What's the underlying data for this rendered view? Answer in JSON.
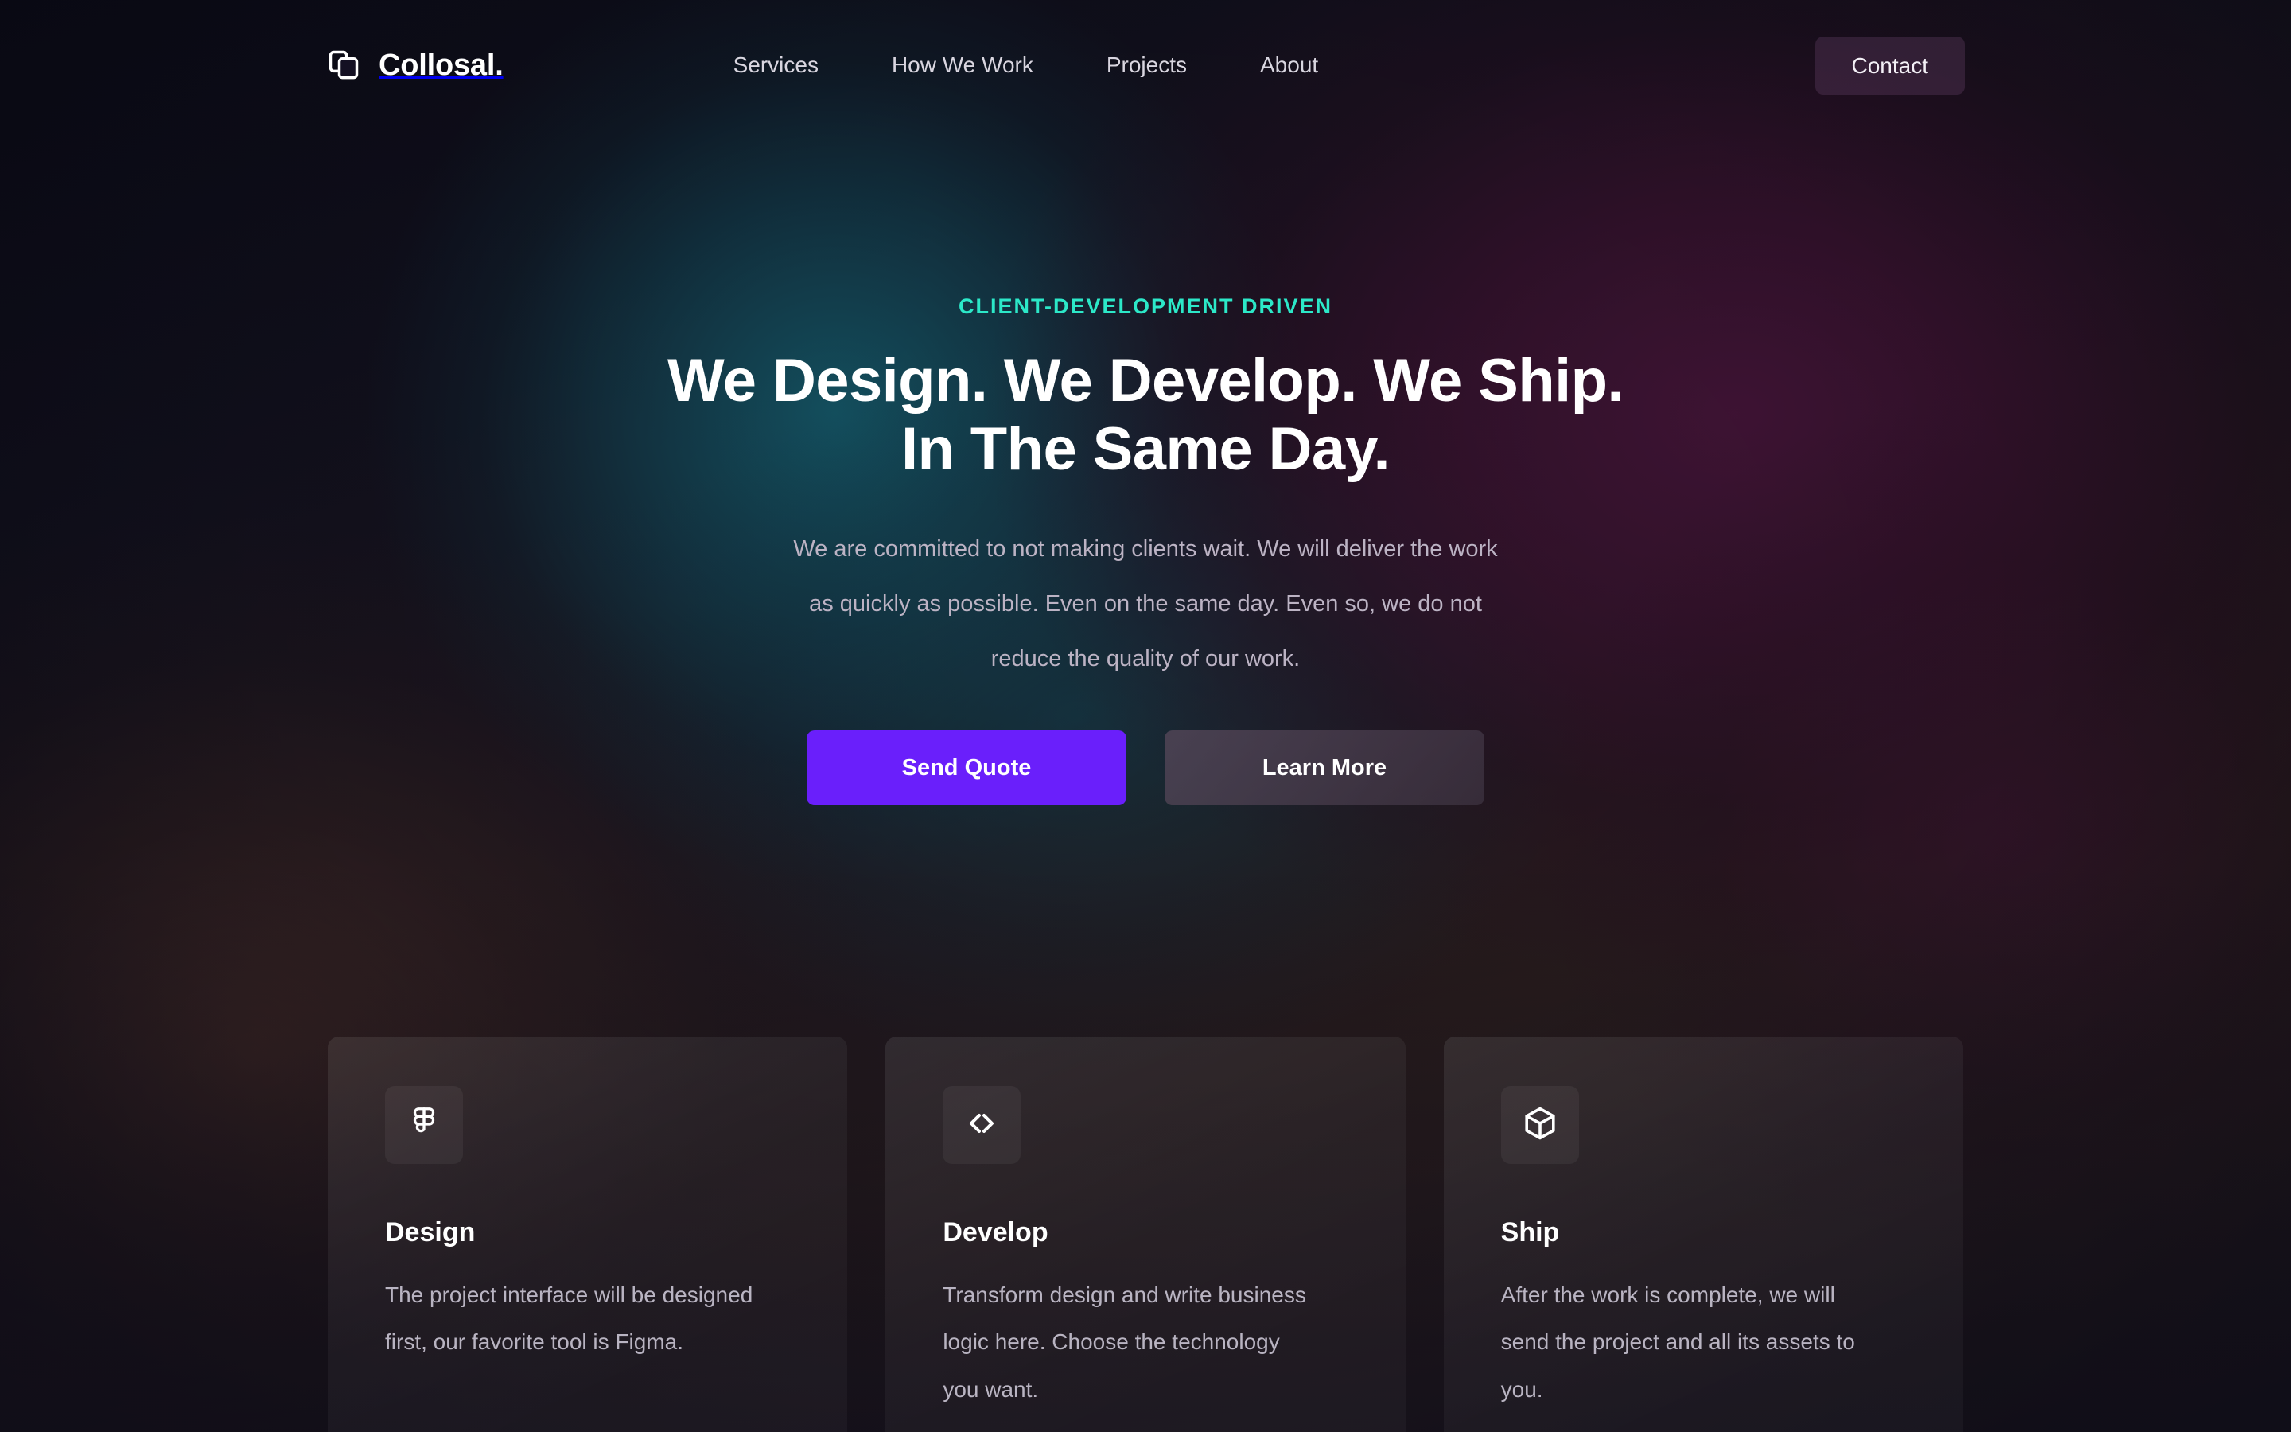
{
  "brand": {
    "name": "Collosal.",
    "icon": "copy-stacked-squares-icon"
  },
  "nav": {
    "links": [
      {
        "label": "Services"
      },
      {
        "label": "How We Work"
      },
      {
        "label": "Projects"
      },
      {
        "label": "About"
      }
    ],
    "contact_label": "Contact"
  },
  "hero": {
    "eyebrow": "CLIENT-DEVELOPMENT DRIVEN",
    "headline_line1": "We Design. We Develop. We Ship.",
    "headline_line2": "In The Same Day.",
    "subcopy_line1": "We are committed to not making clients wait. We will deliver the work",
    "subcopy_line2": "as quickly as possible. Even on the same day. Even so, we do not",
    "subcopy_line3": "reduce the quality of our work.",
    "primary_cta": "Send Quote",
    "secondary_cta": "Learn More"
  },
  "cards": [
    {
      "icon": "figma-icon",
      "title": "Design",
      "text": "The project interface will be designed first, our favorite tool is Figma."
    },
    {
      "icon": "code-brackets-icon",
      "title": "Develop",
      "text": "Transform design and write business logic here. Choose the technology you want."
    },
    {
      "icon": "cube-box-icon",
      "title": "Ship",
      "text": "After the work is complete, we will send the project and all its assets to you."
    }
  ],
  "colors": {
    "accent_cyan": "#2ce8c8",
    "primary_purple": "#6a1ffb",
    "text_primary": "#ffffff",
    "text_muted": "#bcb3c4",
    "background_dark": "#0f0f1c"
  }
}
